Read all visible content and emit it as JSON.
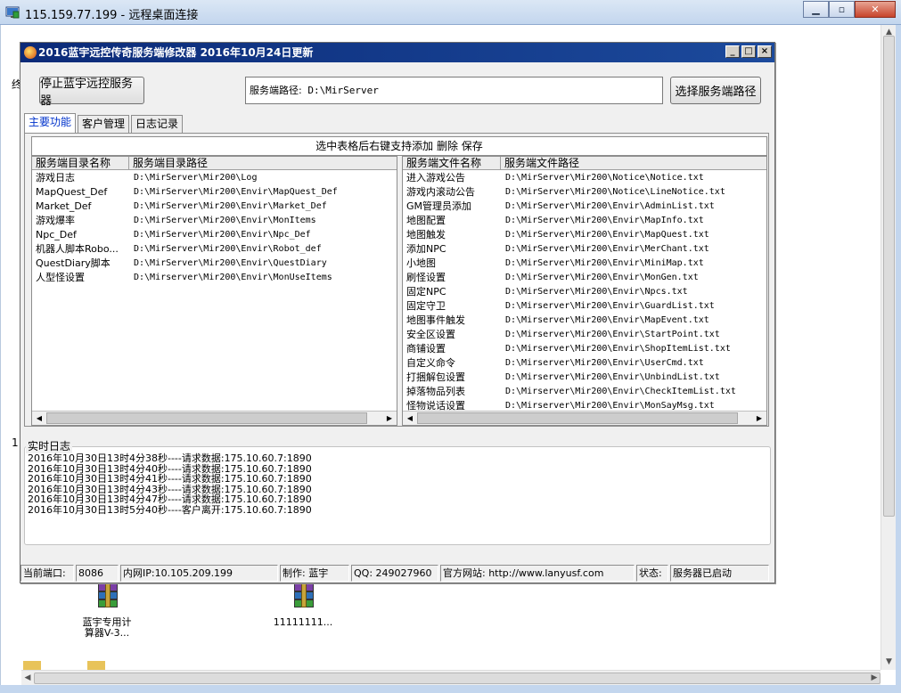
{
  "rdp": {
    "title": "115.159.77.199 - 远程桌面连接",
    "minimize": "▁",
    "restore": "▫",
    "close": "✕"
  },
  "desktop": {
    "icon1_label": "蓝宇专用计\n算器V-3...",
    "icon2_label": "11111111...",
    "edge_chars": [
      "终",
      "1"
    ]
  },
  "app": {
    "title": "2016蓝宇远控传奇服务端修改器 2016年10月24日更新",
    "stop_button": "停止蓝宇远控服务器",
    "path_label": "服务端路径:",
    "path_value": "D:\\MirServer",
    "choose_path_button": "选择服务端路径",
    "tabs": [
      {
        "label": "主要功能",
        "active": true
      },
      {
        "label": "客户管理",
        "active": false
      },
      {
        "label": "日志记录",
        "active": false
      }
    ],
    "caption": "选中表格后右键支持添加 删除 保存",
    "left_list": {
      "headers": [
        "服务端目录名称",
        "服务端目录路径"
      ],
      "rows": [
        [
          "游戏日志",
          "D:\\MirServer\\Mir200\\Log"
        ],
        [
          "MapQuest_Def",
          "D:\\MirServer\\Mir200\\Envir\\MapQuest_Def"
        ],
        [
          "Market_Def",
          "D:\\MirServer\\Mir200\\Envir\\Market_Def"
        ],
        [
          "游戏爆率",
          "D:\\MirServer\\Mir200\\Envir\\MonItems"
        ],
        [
          "Npc_Def",
          "D:\\MirServer\\Mir200\\Envir\\Npc_Def"
        ],
        [
          "机器人脚本Robo...",
          "D:\\MirServer\\Mir200\\Envir\\Robot_def"
        ],
        [
          "QuestDiary脚本",
          "D:\\MirServer\\Mir200\\Envir\\QuestDiary"
        ],
        [
          "人型怪设置",
          "D:\\Mirserver\\Mir200\\Envir\\MonUseItems"
        ]
      ]
    },
    "right_list": {
      "headers": [
        "服务端文件名称",
        "服务端文件路径"
      ],
      "rows": [
        [
          "进入游戏公告",
          "D:\\MirServer\\Mir200\\Notice\\Notice.txt"
        ],
        [
          "游戏内滚动公告",
          "D:\\MirServer\\Mir200\\Notice\\LineNotice.txt"
        ],
        [
          "GM管理员添加",
          "D:\\MirServer\\Mir200\\Envir\\AdminList.txt"
        ],
        [
          "地图配置",
          "D:\\MirServer\\Mir200\\Envir\\MapInfo.txt"
        ],
        [
          "地图触发",
          "D:\\MirServer\\Mir200\\Envir\\MapQuest.txt"
        ],
        [
          "添加NPC",
          "D:\\MirServer\\Mir200\\Envir\\MerChant.txt"
        ],
        [
          "小地图",
          "D:\\MirServer\\Mir200\\Envir\\MiniMap.txt"
        ],
        [
          "刷怪设置",
          "D:\\MirServer\\Mir200\\Envir\\MonGen.txt"
        ],
        [
          "固定NPC",
          "D:\\MirServer\\Mir200\\Envir\\Npcs.txt"
        ],
        [
          "固定守卫",
          "D:\\Mirserver\\Mir200\\Envir\\GuardList.txt"
        ],
        [
          "地图事件触发",
          "D:\\Mirserver\\Mir200\\Envir\\MapEvent.txt"
        ],
        [
          "安全区设置",
          "D:\\Mirserver\\Mir200\\Envir\\StartPoint.txt"
        ],
        [
          "商铺设置",
          "D:\\Mirserver\\Mir200\\Envir\\ShopItemList.txt"
        ],
        [
          "自定义命令",
          "D:\\Mirserver\\Mir200\\Envir\\UserCmd.txt"
        ],
        [
          "打捆解包设置",
          "D:\\Mirserver\\Mir200\\Envir\\UnbindList.txt"
        ],
        [
          "掉落物品列表",
          "D:\\Mirserver\\Mir200\\Envir\\CheckItemList.txt"
        ],
        [
          "怪物说话设置",
          "D:\\Mirserver\\Mir200\\Envir\\MonSayMsg.txt"
        ]
      ]
    },
    "log_title": "实时日志",
    "log_lines": [
      "2016年10月30日13时4分38秒----请求数据:175.10.60.7:1890",
      "2016年10月30日13时4分40秒----请求数据:175.10.60.7:1890",
      "2016年10月30日13时4分41秒----请求数据:175.10.60.7:1890",
      "2016年10月30日13时4分43秒----请求数据:175.10.60.7:1890",
      "2016年10月30日13时4分47秒----请求数据:175.10.60.7:1890",
      "2016年10月30日13时5分40秒----客户离开:175.10.60.7:1890"
    ],
    "status": {
      "port_label": "当前端口:",
      "port_value": "8086",
      "lan_ip": "内网IP:10.105.209.199",
      "author": "制作: 蓝宇",
      "qq": "QQ: 249027960",
      "website": "官方网站: http://www.lanyusf.com",
      "state_label": "状态:",
      "state_value": "服务器已启动"
    }
  }
}
